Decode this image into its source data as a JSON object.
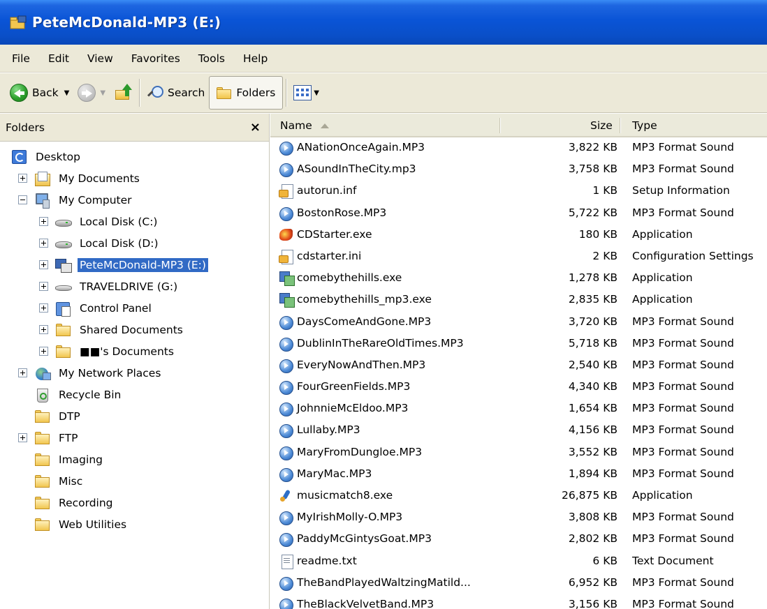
{
  "window": {
    "title": "PeteMcDonald-MP3 (E:)"
  },
  "menu": [
    "File",
    "Edit",
    "View",
    "Favorites",
    "Tools",
    "Help"
  ],
  "toolbar": {
    "back": "Back",
    "search": "Search",
    "folders": "Folders"
  },
  "folders_pane": {
    "title": "Folders",
    "close": "×",
    "tree": [
      {
        "label": "Desktop",
        "level": 0,
        "expander": "none",
        "icon": "desktop-icon"
      },
      {
        "label": "My Documents",
        "level": 1,
        "expander": "plus",
        "icon": "my-documents-icon"
      },
      {
        "label": "My Computer",
        "level": 1,
        "expander": "minus",
        "icon": "my-computer-icon"
      },
      {
        "label": "Local Disk (C:)",
        "level": 2,
        "expander": "plus",
        "icon": "hard-disk-icon"
      },
      {
        "label": "Local Disk (D:)",
        "level": 2,
        "expander": "plus",
        "icon": "hard-disk-icon"
      },
      {
        "label": "PeteMcDonald-MP3 (E:)",
        "level": 2,
        "expander": "plus",
        "icon": "cd-drive-icon",
        "selected": true
      },
      {
        "label": "TRAVELDRIVE (G:)",
        "level": 2,
        "expander": "plus",
        "icon": "removable-drive-icon"
      },
      {
        "label": "Control Panel",
        "level": 2,
        "expander": "plus",
        "icon": "control-panel-icon"
      },
      {
        "label": "Shared Documents",
        "level": 2,
        "expander": "plus",
        "icon": "folder-icon"
      },
      {
        "label": "■■'s Documents",
        "level": 2,
        "expander": "plus",
        "icon": "folder-icon"
      },
      {
        "label": "My Network Places",
        "level": 1,
        "expander": "plus",
        "icon": "network-places-icon"
      },
      {
        "label": "Recycle Bin",
        "level": 1,
        "expander": "none",
        "icon": "recycle-bin-icon"
      },
      {
        "label": "DTP",
        "level": 1,
        "expander": "none",
        "icon": "folder-icon"
      },
      {
        "label": "FTP",
        "level": 1,
        "expander": "plus",
        "icon": "folder-icon"
      },
      {
        "label": "Imaging",
        "level": 1,
        "expander": "none",
        "icon": "folder-icon"
      },
      {
        "label": "Misc",
        "level": 1,
        "expander": "none",
        "icon": "folder-icon"
      },
      {
        "label": "Recording",
        "level": 1,
        "expander": "none",
        "icon": "folder-icon"
      },
      {
        "label": "Web Utilities",
        "level": 1,
        "expander": "none",
        "icon": "folder-icon"
      }
    ]
  },
  "file_list": {
    "columns": {
      "name": "Name",
      "size": "Size",
      "type": "Type"
    },
    "rows": [
      {
        "name": "ANationOnceAgain.MP3",
        "size": "3,822 KB",
        "type": "MP3 Format Sound",
        "icon": "mp3"
      },
      {
        "name": "ASoundInTheCity.mp3",
        "size": "3,758 KB",
        "type": "MP3 Format Sound",
        "icon": "mp3"
      },
      {
        "name": "autorun.inf",
        "size": "1 KB",
        "type": "Setup Information",
        "icon": "inf"
      },
      {
        "name": "BostonRose.MP3",
        "size": "5,722 KB",
        "type": "MP3 Format Sound",
        "icon": "mp3"
      },
      {
        "name": "CDStarter.exe",
        "size": "180 KB",
        "type": "Application",
        "icon": "cdstart"
      },
      {
        "name": "cdstarter.ini",
        "size": "2 KB",
        "type": "Configuration Settings",
        "icon": "inf"
      },
      {
        "name": "comebythehills.exe",
        "size": "1,278 KB",
        "type": "Application",
        "icon": "exe"
      },
      {
        "name": "comebythehills_mp3.exe",
        "size": "2,835 KB",
        "type": "Application",
        "icon": "exe"
      },
      {
        "name": "DaysComeAndGone.MP3",
        "size": "3,720 KB",
        "type": "MP3 Format Sound",
        "icon": "mp3"
      },
      {
        "name": "DublinInTheRareOldTimes.MP3",
        "size": "5,718 KB",
        "type": "MP3 Format Sound",
        "icon": "mp3"
      },
      {
        "name": "EveryNowAndThen.MP3",
        "size": "2,540 KB",
        "type": "MP3 Format Sound",
        "icon": "mp3"
      },
      {
        "name": "FourGreenFields.MP3",
        "size": "4,340 KB",
        "type": "MP3 Format Sound",
        "icon": "mp3"
      },
      {
        "name": "JohnnieMcEldoo.MP3",
        "size": "1,654 KB",
        "type": "MP3 Format Sound",
        "icon": "mp3"
      },
      {
        "name": "Lullaby.MP3",
        "size": "4,156 KB",
        "type": "MP3 Format Sound",
        "icon": "mp3"
      },
      {
        "name": "MaryFromDungloe.MP3",
        "size": "3,552 KB",
        "type": "MP3 Format Sound",
        "icon": "mp3"
      },
      {
        "name": "MaryMac.MP3",
        "size": "1,894 KB",
        "type": "MP3 Format Sound",
        "icon": "mp3"
      },
      {
        "name": "musicmatch8.exe",
        "size": "26,875 KB",
        "type": "Application",
        "icon": "musicmatch"
      },
      {
        "name": "MyIrishMolly-O.MP3",
        "size": "3,808 KB",
        "type": "MP3 Format Sound",
        "icon": "mp3"
      },
      {
        "name": "PaddyMcGintysGoat.MP3",
        "size": "2,802 KB",
        "type": "MP3 Format Sound",
        "icon": "mp3"
      },
      {
        "name": "readme.txt",
        "size": "6 KB",
        "type": "Text Document",
        "icon": "txt"
      },
      {
        "name": "TheBandPlayedWaltzingMatild...",
        "size": "6,952 KB",
        "type": "MP3 Format Sound",
        "icon": "mp3"
      },
      {
        "name": "TheBlackVelvetBand.MP3",
        "size": "3,156 KB",
        "type": "MP3 Format Sound",
        "icon": "mp3"
      }
    ]
  }
}
